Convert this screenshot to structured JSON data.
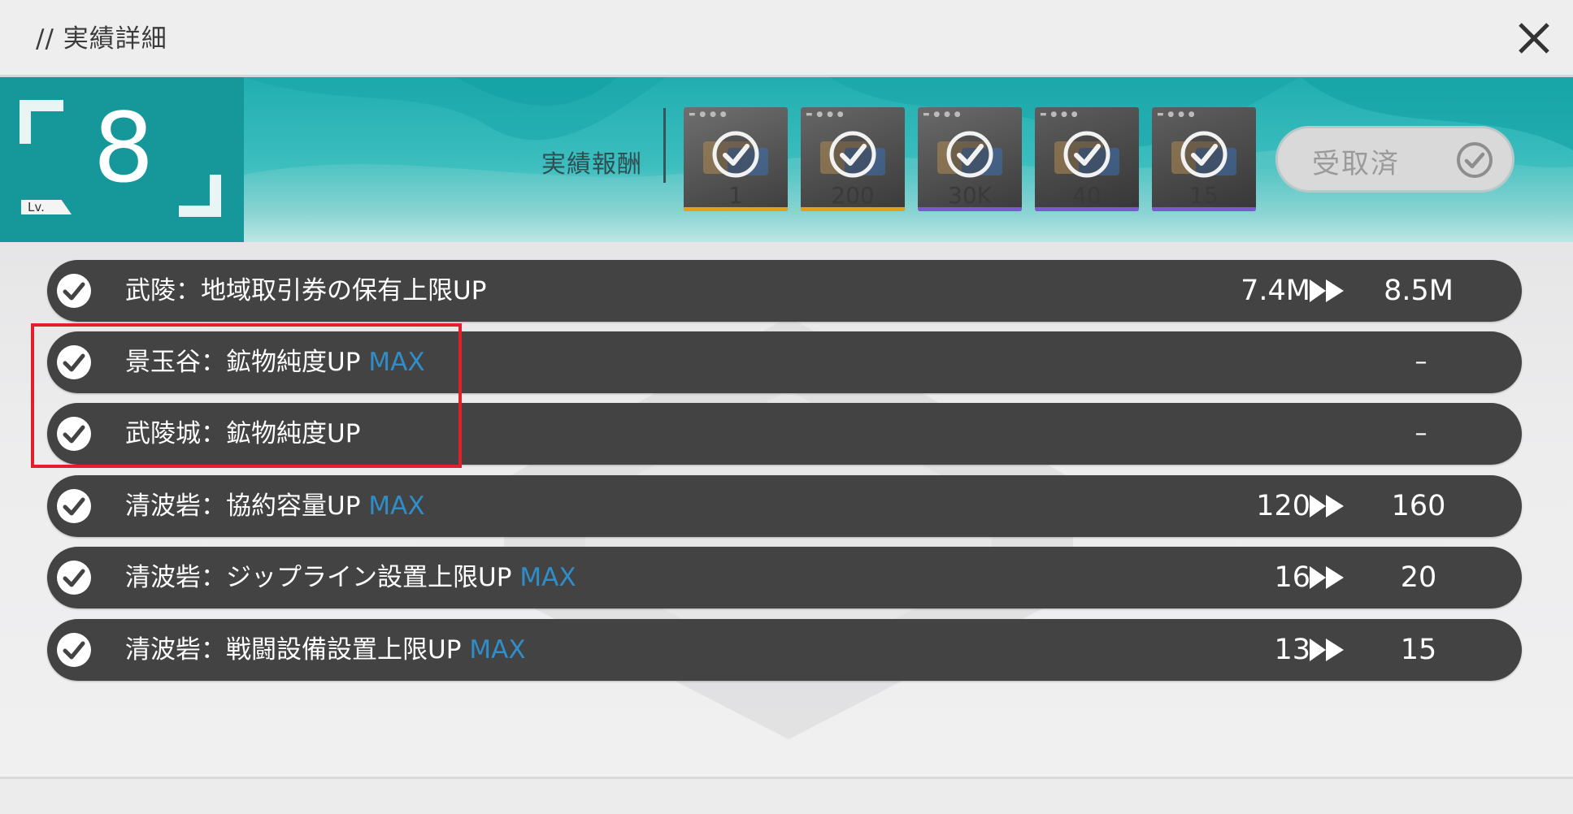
{
  "header": {
    "title": "// 実績詳細"
  },
  "level": {
    "number": "8",
    "tag": "Lv."
  },
  "rewards": {
    "label": "実績報酬",
    "items": [
      {
        "qty": "1",
        "rarity_color": "#e0a21b"
      },
      {
        "qty": "200",
        "rarity_color": "#e0a21b"
      },
      {
        "qty": "30K",
        "rarity_color": "#7b5ad1"
      },
      {
        "qty": "40",
        "rarity_color": "#7b5ad1"
      },
      {
        "qty": "15",
        "rarity_color": "#7b5ad1"
      }
    ]
  },
  "claim_button": {
    "label": "受取済"
  },
  "rows": [
    {
      "text": "武陵：地域取引券の保有上限UP",
      "max": "",
      "from": "7.4M",
      "to": "8.5M",
      "dash": ""
    },
    {
      "text": "景玉谷：鉱物純度UP",
      "max": "MAX",
      "from": "",
      "to": "",
      "dash": "–"
    },
    {
      "text": "武陵城：鉱物純度UP",
      "max": "",
      "from": "",
      "to": "",
      "dash": "–"
    },
    {
      "text": "清波砦：協約容量UP",
      "max": "MAX",
      "from": "120",
      "to": "160",
      "dash": ""
    },
    {
      "text": "清波砦：ジップライン設置上限UP",
      "max": "MAX",
      "from": "16",
      "to": "20",
      "dash": ""
    },
    {
      "text": "清波砦：戦闘設備設置上限UP",
      "max": "MAX",
      "from": "13",
      "to": "15",
      "dash": ""
    }
  ],
  "colors": {
    "accent_teal": "#21aeb0",
    "max_blue": "#2f8ec9",
    "highlight_red": "#e1202c"
  }
}
